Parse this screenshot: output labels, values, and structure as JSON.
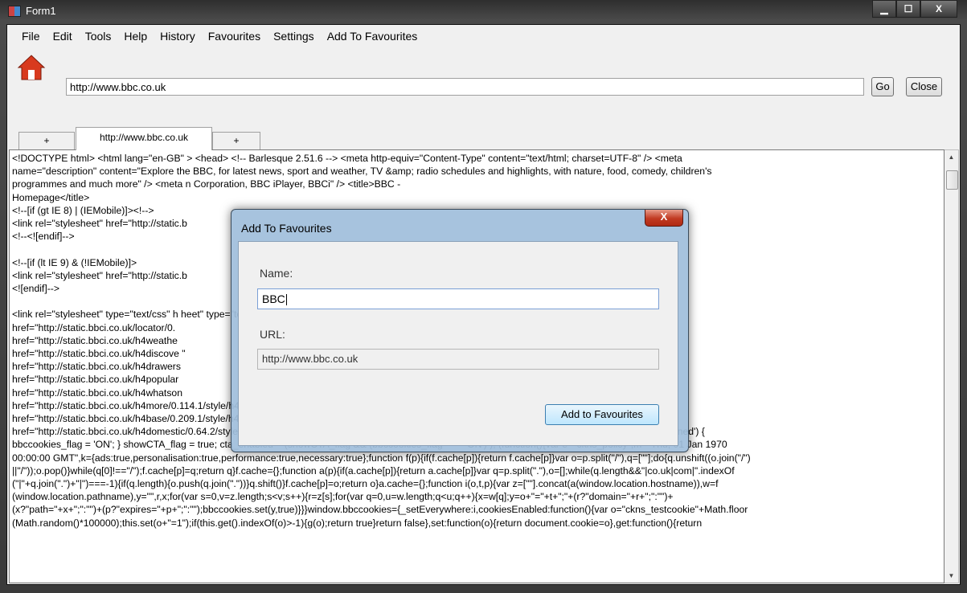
{
  "window": {
    "title": "Form1",
    "min_symbol": "▁",
    "max_symbol": "☐",
    "close_symbol": "X"
  },
  "menu": [
    "File",
    "Edit",
    "Tools",
    "Help",
    "History",
    "Favourites",
    "Settings",
    "Add To Favourites"
  ],
  "address": {
    "url": "http://www.bbc.co.uk",
    "go_label": "Go",
    "close_label": "Close"
  },
  "tabs": [
    "+",
    "http://www.bbc.co.uk",
    "+"
  ],
  "source_lines": [
    "<!DOCTYPE html> <html lang=\"en-GB\" > <head> <!-- Barlesque 2.51.6 --> <meta http-equiv=\"Content-Type\" content=\"text/html; charset=UTF-8\" /> <meta",
    "name=\"description\" content=\"Explore the BBC, for latest news, sport and weather, TV &amp; radio schedules and highlights, with nature, food, comedy, children's",
    "programmes and much more\" /> <meta n                                                                                     Corporation, BBC iPlayer, BBCi\" />  <title>BBC -",
    "Homepage</title>",
    "<!--[if (gt IE 8) | (IEMobile)]><!-->",
    "<link rel=\"stylesheet\" href=\"http://static.b",
    "<!--<![endif]-->",
    "",
    "<!--[if (lt IE 9) & (!IEMobile)]>",
    "<link rel=\"stylesheet\" href=\"http://static.b",
    "<![endif]-->",
    "",
    "  <link rel=\"stylesheet\" type=\"text/css\" h                                                                                     heet\" type=\"text/css\"",
    "href=\"http://static.bbci.co.uk/locator/0.",
    "href=\"http://static.bbci.co.uk/h4weathe",
    "href=\"http://static.bbci.co.uk/h4discove                                                                                    \"",
    "href=\"http://static.bbci.co.uk/h4drawers",
    "href=\"http://static.bbci.co.uk/h4popular",
    "href=\"http://static.bbci.co.uk/h4whatson",
    "href=\"http://static.bbci.co.uk/h4more/0.114.1/style/h4more.css\"  />  <link rel=\"stylesheet\" type=\"text/css\"",
    "href=\"http://static.bbci.co.uk/h4base/0.209.1/style/h4base.css\"  />  <link rel=\"stylesheet\" type=\"text/css\"",
    "href=\"http://static.bbci.co.uk/h4domestic/0.64.2/style/h4domestic.css\"  />  <script type=\"text/javascript\">/*<![CDATA[*/ if (typeof bbccookies_flag === 'undefined') {",
    "bbccookies_flag = 'ON'; } showCTA_flag = true; cta_enabled = (showCTA_flag && (bbccookies_flag === 'ON') ); (function(){var e=\"ckns_policy\",m=\"Thu, 01 Jan 1970",
    "00:00:00 GMT\",k={ads:true,personalisation:true,performance:true,necessary:true};function f(p){if(f.cache[p]){return f.cache[p]}var o=p.split(\"/\"),q=[\"\"];do{q.unshift((o.join(\"/\")",
    "||\"/\"));o.pop()}while(q[0]!==\"/\");f.cache[p]=q;return q}f.cache={};function a(p){if(a.cache[p]){return a.cache[p]}var q=p.split(\".\"),o=[];while(q.length&&\"|co.uk|com|\".indexOf",
    "(\"|\"+q.join(\".\")+\"|\")===-1){if(q.length){o.push(q.join(\".\"))}q.shift()}f.cache[p]=o;return o}a.cache={};function i(o,t,p){var z=[\"\"].concat(a(window.location.hostname)),w=f",
    "(window.location.pathname),y=\"\",r,x;for(var s=0,v=z.length;s<v;s++){r=z[s];for(var q=0,u=w.length;q<u;q++){x=w[q];y=o+\"=\"+t+\";\"+(r?\"domain=\"+r+\";\":\"\")+",
    "(x?\"path=\"+x+\";\":\"\")+(p?\"expires=\"+p+\";\":\"\");bbccookies.set(y,true)}}}window.bbccookies={_setEverywhere:i,cookiesEnabled:function(){var o=\"ckns_testcookie\"+Math.floor",
    "(Math.random()*100000);this.set(o+\"=1\");if(this.get().indexOf(o)>-1){g(o);return true}return false},set:function(o){return document.cookie=o},get:function(){return"
  ],
  "dialog": {
    "title": "Add To Favourites",
    "close_symbol": "X",
    "name_label": "Name:",
    "name_value": "BBC",
    "url_label": "URL:",
    "url_value": "http://www.bbc.co.uk",
    "add_label": "Add to Favourites"
  },
  "scroll": {
    "up": "▲",
    "down": "▼"
  }
}
